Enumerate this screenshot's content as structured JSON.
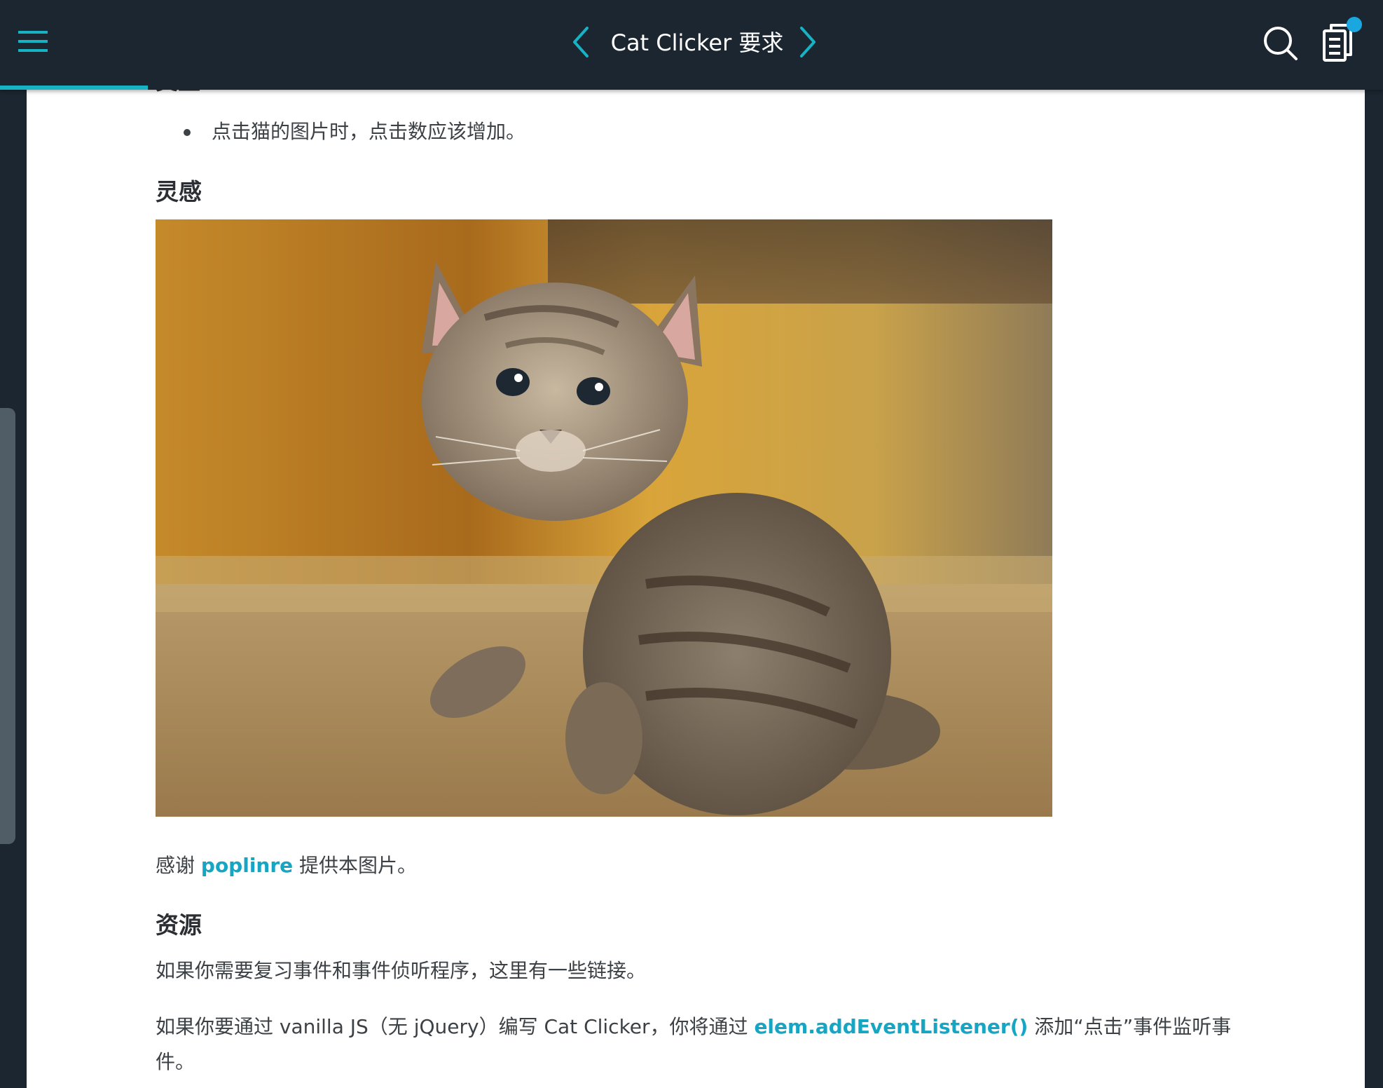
{
  "header": {
    "title": "Cat Clicker 要求",
    "progress_fraction": 0.107,
    "icons": {
      "menu": "hamburger-menu-icon",
      "prev": "chevron-left-icon",
      "next": "chevron-right-icon",
      "search": "search-icon",
      "notes": "notes-icon"
    }
  },
  "colors": {
    "accent": "#17b3c4",
    "link": "#17a5c4",
    "header_bg": "#1b2630",
    "notification_dot": "#1aa7e0"
  },
  "content": {
    "cut_heading": "交互",
    "bullets": [
      "点击猫的图片时，点击数应该增加。"
    ],
    "inspiration_heading": "灵感",
    "credit": {
      "before": "感谢 ",
      "link": "poplinre",
      "after": " 提供本图片。"
    },
    "resources_heading": "资源",
    "resources_intro": "如果你需要复习事件和事件侦听程序，这里有一些链接。",
    "vanilla": {
      "before": "如果你要通过 vanilla JS（无 jQuery）编写 Cat Clicker，你将通过 ",
      "link": "elem.addEventListener()",
      "after": " 添加“点击”事件监听事件。"
    }
  }
}
